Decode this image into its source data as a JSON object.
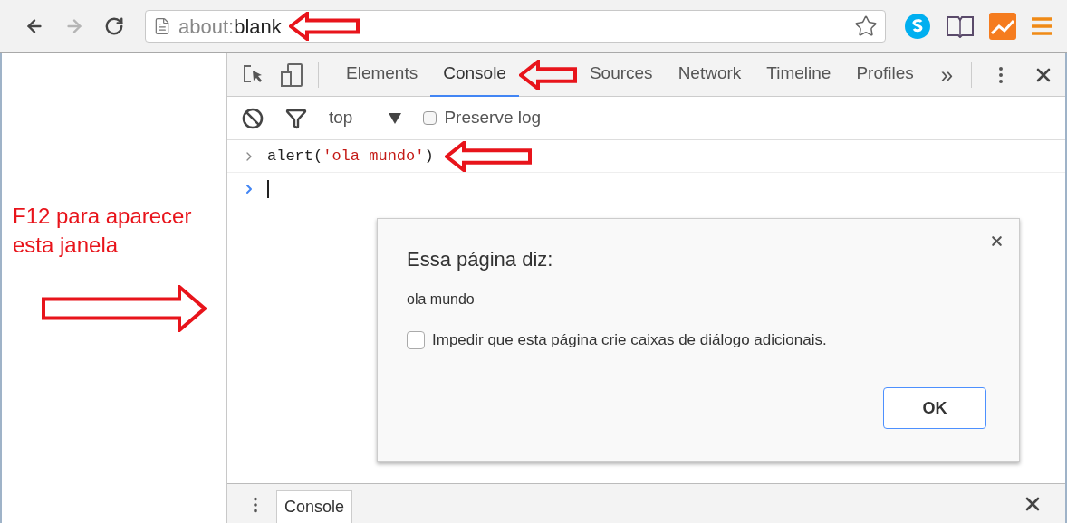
{
  "browser": {
    "nav": [
      {
        "kind": "back",
        "disabled": false
      },
      {
        "kind": "forward",
        "disabled": true
      },
      {
        "kind": "reload",
        "disabled": false
      }
    ],
    "address": {
      "scheme": "about:",
      "path": "blank"
    }
  },
  "page": {
    "annotation": "F12 para aparecer esta janela"
  },
  "devtools": {
    "tabs": [
      {
        "label": "Elements",
        "selected": false
      },
      {
        "label": "Console",
        "selected": true
      },
      {
        "label": "Sources",
        "selected": false
      },
      {
        "label": "Network",
        "selected": false
      },
      {
        "label": "Timeline",
        "selected": false
      },
      {
        "label": "Profiles",
        "selected": false
      }
    ],
    "more": "»",
    "console_toolbar": {
      "context": "top",
      "preserve_log": {
        "label": "Preserve log",
        "checked": false
      }
    },
    "console_lines": [
      {
        "kind": "input",
        "parts": [
          {
            "kind": "plain",
            "text": "alert("
          },
          {
            "kind": "string",
            "text": "'ola mundo'"
          },
          {
            "kind": "plain",
            "text": ")"
          }
        ]
      },
      {
        "kind": "prompt"
      }
    ],
    "drawer": {
      "tabs": [
        {
          "label": "Console",
          "selected": true
        }
      ]
    }
  },
  "dialog": {
    "title": "Essa página diz:",
    "message": "ola mundo",
    "checkbox": {
      "label": "Impedir que esta página crie caixas de diálogo adicionais.",
      "checked": false
    },
    "button": "OK"
  }
}
